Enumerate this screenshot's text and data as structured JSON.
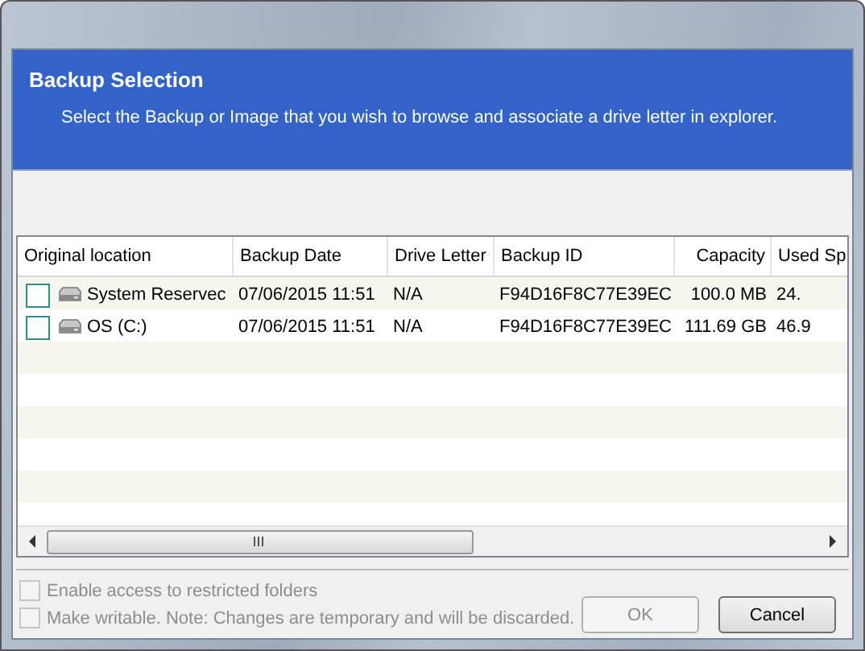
{
  "dialog": {
    "title": "Backup Selection",
    "subtitle": "Select the Backup or Image that you wish to browse and associate a drive letter in explorer."
  },
  "table": {
    "columns": [
      {
        "label": "Original location"
      },
      {
        "label": "Backup Date"
      },
      {
        "label": "Drive Letter"
      },
      {
        "label": "Backup ID"
      },
      {
        "label": "Capacity"
      },
      {
        "label": "Used Sp"
      }
    ],
    "rows": [
      {
        "checked": false,
        "cells": [
          "System Reservec",
          "07/06/2015 11:51",
          "N/A",
          "F94D16F8C77E39EC",
          "100.0 MB",
          "24."
        ]
      },
      {
        "checked": false,
        "cells": [
          "OS (C:)",
          "07/06/2015 11:51",
          "N/A",
          "F94D16F8C77E39EC",
          "111.69 GB",
          "46.9"
        ]
      }
    ]
  },
  "options": [
    {
      "label": "Enable access to restricted folders",
      "checked": false,
      "disabled": true
    },
    {
      "label": "Make writable. Note: Changes are temporary and will be discarded.",
      "checked": false,
      "disabled": true
    }
  ],
  "buttons": [
    {
      "label": "OK",
      "disabled": true
    },
    {
      "label": "Cancel",
      "disabled": false
    }
  ]
}
